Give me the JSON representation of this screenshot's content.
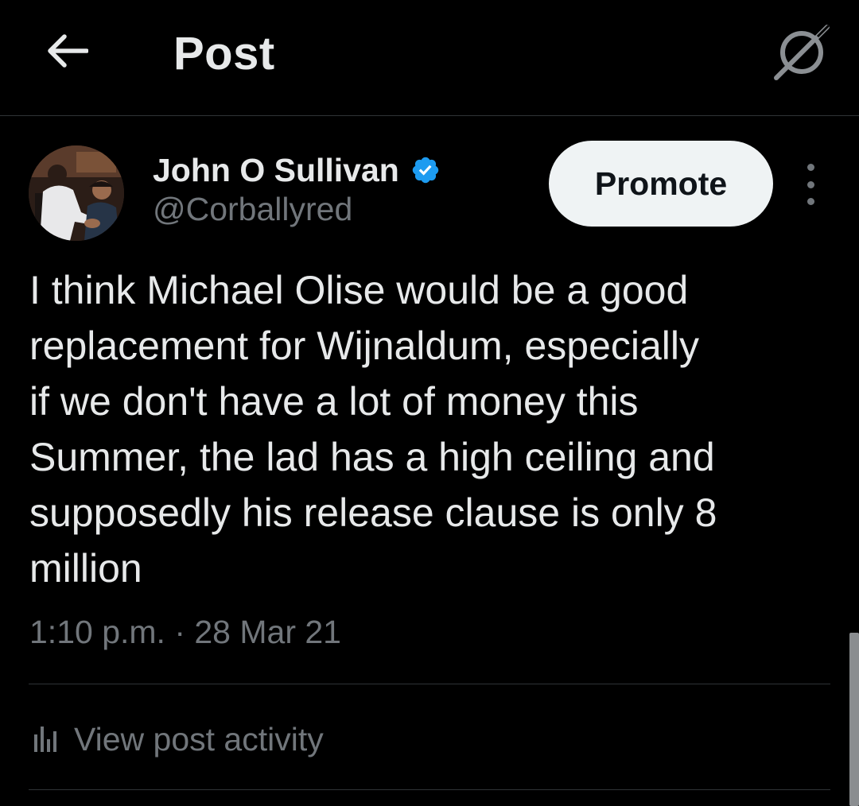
{
  "header": {
    "title": "Post",
    "back_icon": "arrow-left-icon",
    "grok_icon": "grok-icon"
  },
  "author": {
    "display_name": "John O Sullivan",
    "handle": "@Corballyred",
    "verified": true,
    "verified_color": "#1d9bf0"
  },
  "actions": {
    "promote_label": "Promote",
    "more_icon": "more-vertical-icon"
  },
  "post": {
    "text": "I think Michael Olise would be a good\nreplacement for Wijnaldum, especially\nif we don't have a lot of money this\nSummer, the lad has a high ceiling and\nsupposedly his release clause is only 8\nmillion",
    "timestamp": "1:10 p.m. · 28 Mar 21"
  },
  "activity": {
    "label": "View post activity",
    "icon": "analytics-icon"
  },
  "colors": {
    "background": "#000000",
    "text_primary": "#e7e9ea",
    "text_secondary": "#71767b",
    "divider": "#2f3336",
    "button_bg": "#eff3f4"
  }
}
